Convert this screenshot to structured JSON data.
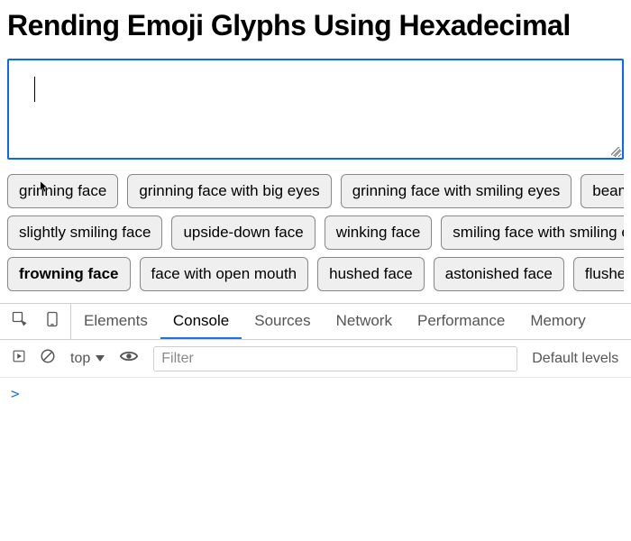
{
  "page": {
    "title": "Rending Emoji Glyphs Using Hexadecimal"
  },
  "textarea": {
    "value": "",
    "placeholder": ""
  },
  "buttons": {
    "row1": [
      {
        "label": "grinning face",
        "bold": false
      },
      {
        "label": "grinning face with big eyes",
        "bold": false
      },
      {
        "label": "grinning face with smiling eyes",
        "bold": false
      },
      {
        "label": "beaming face with smiling eyes",
        "bold": false
      }
    ],
    "row2": [
      {
        "label": "slightly smiling face",
        "bold": false
      },
      {
        "label": "upside-down face",
        "bold": false
      },
      {
        "label": "winking face",
        "bold": false
      },
      {
        "label": "smiling face with smiling eyes",
        "bold": false
      }
    ],
    "row3": [
      {
        "label": "frowning face",
        "bold": true
      },
      {
        "label": "face with open mouth",
        "bold": false
      },
      {
        "label": "hushed face",
        "bold": false
      },
      {
        "label": "astonished face",
        "bold": false
      },
      {
        "label": "flushed face",
        "bold": false
      }
    ]
  },
  "devtools": {
    "tabs": {
      "elements": "Elements",
      "console": "Console",
      "sources": "Sources",
      "network": "Network",
      "performance": "Performance",
      "memory": "Memory"
    },
    "active_tab": "console",
    "toolbar": {
      "context": "top",
      "filter_placeholder": "Filter",
      "levels": "Default levels"
    },
    "console_body": {
      "prompt": ">"
    }
  }
}
